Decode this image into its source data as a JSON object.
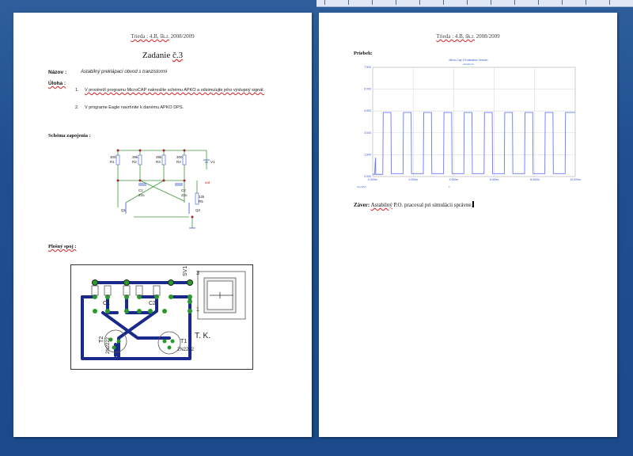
{
  "header": {
    "class_label": "Trieda : 4.B, šk.r.",
    "year": "2008/2009"
  },
  "page1": {
    "title_prefix": "Zadanie ",
    "title_number": "č.3",
    "nazov_label": "Názov :",
    "nazov_value": "Astabilný preklápací obvod s tranzistormi",
    "uloha_label": "Úloha :",
    "tasks": [
      "V prostredí programu MicroCAP nakreslite schému APKO a odsimulujte jeho výstupný signál.",
      "V programe Eagle navrhnite k danému APKO DPS."
    ],
    "task_numbers": [
      "1.",
      "2."
    ],
    "schema_label": "Schéma zapojenia :",
    "ploSny_label": "Plošný spoj :",
    "schematic": {
      "r_labels": [
        "300\nR1",
        "39k\nR2",
        "39k\nR3",
        "300\nR4"
      ],
      "c1": "C1\n22u",
      "c2": "C2\n22u",
      "v1": "V1",
      "r5": "12k\nR5",
      "q1": "Q1",
      "q2": "Q2",
      "out": "out"
    },
    "pcb": {
      "sv1": "SV1",
      "pin3": "3",
      "pin1": "1",
      "c1": "C1",
      "c2": "C2",
      "t1": "T1",
      "t2": "T2",
      "t1_part": "2N2222",
      "t2_part": "2N2222",
      "initials": "T. K."
    }
  },
  "page2": {
    "priebeh_label": "Priebeh:",
    "zaver_label": "Záver:",
    "zaver_word1": "Astabilný",
    "zaver_rest": " P.O. pracoval pri simulácii správne."
  },
  "chart_data": {
    "type": "line",
    "title": "Micro-Cap 9 Evaluation Version",
    "subtitle": "circuit1.cir",
    "x": [
      0,
      0.1,
      0.12,
      0.145,
      0.15,
      0.152,
      0.5,
      0.52,
      0.9,
      0.92,
      1.5,
      1.52,
      1.9,
      1.92,
      2.5,
      2.52,
      2.9,
      2.92,
      3.5,
      3.52,
      3.9,
      3.92,
      4.5,
      4.52,
      4.9,
      4.92,
      5.5,
      5.52,
      5.9,
      5.92,
      6.5,
      6.52,
      6.9,
      6.92,
      7.5,
      7.52,
      7.9,
      7.92,
      8.5,
      8.52,
      8.9,
      8.92,
      9.5,
      9.52,
      10.0
    ],
    "values": [
      0.15,
      0.15,
      0.9,
      1.3,
      0.2,
      0.15,
      0.15,
      4.4,
      4.4,
      0.2,
      0.2,
      4.4,
      4.4,
      0.2,
      0.2,
      4.4,
      4.4,
      0.2,
      0.2,
      4.4,
      4.4,
      0.2,
      0.2,
      4.4,
      4.4,
      0.2,
      0.2,
      4.4,
      4.4,
      0.2,
      0.2,
      4.4,
      4.4,
      0.2,
      0.2,
      4.4,
      4.4,
      0.2,
      0.2,
      4.4,
      4.4,
      0.2,
      0.2,
      4.4,
      4.4
    ],
    "xlim": [
      0,
      10
    ],
    "ylim": [
      0,
      7.5
    ],
    "x_ticks": [
      "0.000",
      "2.000",
      "4.000",
      "6.000",
      "8.000",
      "10.000"
    ],
    "y_ticks": [
      "0.000",
      "1.500",
      "3.000",
      "4.500",
      "6.000",
      "7.500"
    ],
    "x_unit": "m",
    "x_axis_tag": "v(out)(V)",
    "xlabel": "T",
    "grid": true,
    "line_color": "#6a78ff"
  }
}
